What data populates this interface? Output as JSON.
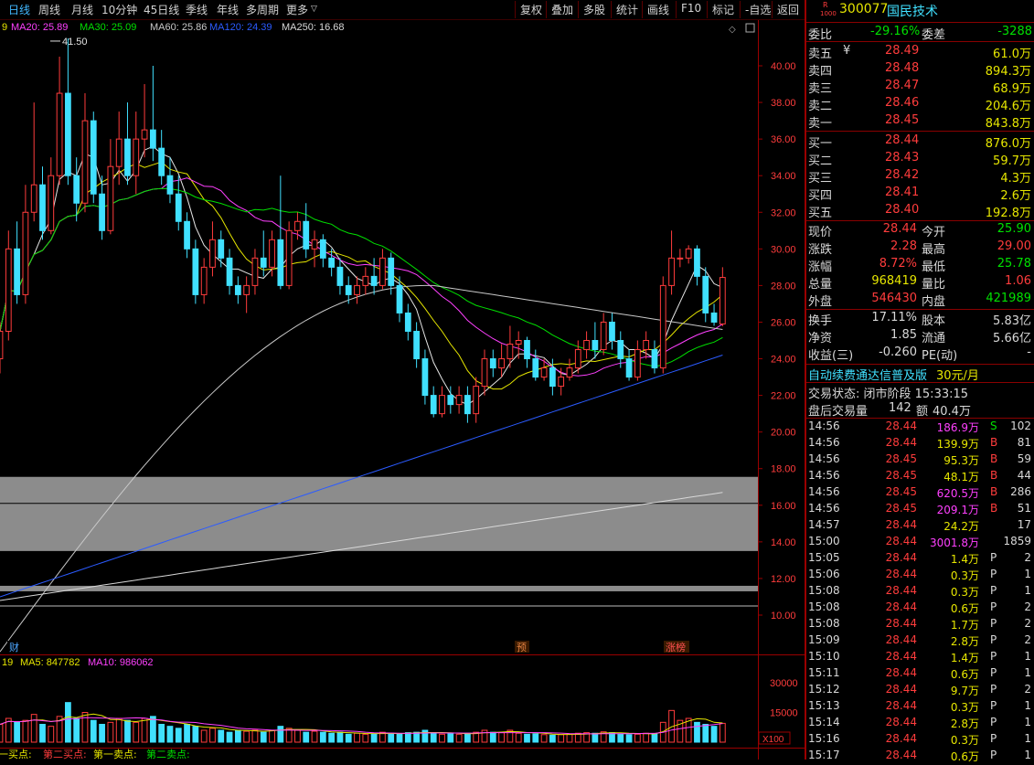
{
  "toolbar": {
    "left": [
      "日线",
      "周线",
      "月线",
      "10分钟",
      "45日线",
      "季线",
      "年线",
      "多周期",
      "更多"
    ],
    "more_arrow": "▽",
    "right": [
      "复权",
      "叠加",
      "多股",
      "统计",
      "画线",
      "F10",
      "标记",
      "-自选",
      "返回"
    ]
  },
  "ma_legend": {
    "first_fragment": "9",
    "items": [
      {
        "label": "MA20: 25.89",
        "color": "#ff40ff"
      },
      {
        "label": "MA30: 25.09",
        "color": "#00e000"
      },
      {
        "label": "MA60: 25.86",
        "color": "#c8c8c8"
      },
      {
        "label": "MA120: 24.39",
        "color": "#2b5bff"
      },
      {
        "label": "MA250: 16.68",
        "color": "#d8d8d8"
      }
    ]
  },
  "price_axis": [
    "40.00",
    "38.00",
    "36.00",
    "34.00",
    "32.00",
    "30.00",
    "28.00",
    "26.00",
    "24.00",
    "22.00",
    "20.00",
    "18.00",
    "16.00",
    "14.00",
    "12.00",
    "10.00"
  ],
  "high_marker": "41.50",
  "event_flags": [
    {
      "label": "财",
      "color": "#4da6ff"
    },
    {
      "label": "预",
      "color": "#e08040"
    },
    {
      "label": "涨榜",
      "color": "#ff5050"
    }
  ],
  "vol_legend": {
    "first": "19",
    "ma5": "MA5: 847782",
    "ma10": "MA10: 986062"
  },
  "vol_axis": [
    "30000",
    "15000"
  ],
  "vol_unit": "X100",
  "signals": [
    "第一买点:",
    "第二买点:",
    "第一卖点:",
    "第二卖点:"
  ],
  "signal_first_fragment": "一买点:",
  "stock": {
    "code": "300077",
    "name": "国民技术",
    "badge_top": "R",
    "badge_bottom": "1000"
  },
  "weibi": {
    "label": "委比",
    "value": "-29.16%",
    "diff_label": "委差",
    "diff": "-3288"
  },
  "asks": [
    {
      "label": "卖五",
      "price": "28.49",
      "vol": "61.0万"
    },
    {
      "label": "卖四",
      "price": "28.48",
      "vol": "894.3万"
    },
    {
      "label": "卖三",
      "price": "28.47",
      "vol": "68.9万"
    },
    {
      "label": "卖二",
      "price": "28.46",
      "vol": "204.6万"
    },
    {
      "label": "卖一",
      "price": "28.45",
      "vol": "843.8万"
    }
  ],
  "ask_currency_mark": "¥",
  "bids": [
    {
      "label": "买一",
      "price": "28.44",
      "vol": "876.0万"
    },
    {
      "label": "买二",
      "price": "28.43",
      "vol": "59.7万"
    },
    {
      "label": "买三",
      "price": "28.42",
      "vol": "4.3万"
    },
    {
      "label": "买四",
      "price": "28.41",
      "vol": "2.6万"
    },
    {
      "label": "买五",
      "price": "28.40",
      "vol": "192.8万"
    }
  ],
  "quote": [
    {
      "l1": "现价",
      "v1": "28.44",
      "c1": "r",
      "l2": "今开",
      "v2": "25.90",
      "c2": "g"
    },
    {
      "l1": "涨跌",
      "v1": "2.28",
      "c1": "r",
      "l2": "最高",
      "v2": "29.00",
      "c2": "r"
    },
    {
      "l1": "涨幅",
      "v1": "8.72%",
      "c1": "r",
      "l2": "最低",
      "v2": "25.78",
      "c2": "g"
    },
    {
      "l1": "总量",
      "v1": "968419",
      "c1": "y",
      "l2": "量比",
      "v2": "1.06",
      "c2": "r"
    },
    {
      "l1": "外盘",
      "v1": "546430",
      "c1": "r",
      "l2": "内盘",
      "v2": "421989",
      "c2": "g"
    }
  ],
  "fundamentals": [
    {
      "l1": "换手",
      "v1": "17.11%",
      "l2": "股本",
      "v2": "5.83亿"
    },
    {
      "l1": "净资",
      "v1": "1.85",
      "l2": "流通",
      "v2": "5.66亿"
    },
    {
      "l1": "收益(三)",
      "v1": "-0.260",
      "l2": "PE(动)",
      "v2": "-"
    }
  ],
  "promo": {
    "text": "自动续费通达信普及版",
    "price": "30元/月"
  },
  "trade_status": {
    "label": "交易状态: 闭市阶段 15:33:15"
  },
  "after_hours": {
    "label": "盘后交易量",
    "vol": "142",
    "amt_label": "额",
    "amt": "40.4万"
  },
  "ticks": [
    {
      "t": "14:56",
      "p": "28.44",
      "v": "186.9万",
      "vc": "m",
      "s": "S",
      "sc": "g",
      "n": "102"
    },
    {
      "t": "14:56",
      "p": "28.44",
      "v": "139.9万",
      "vc": "y",
      "s": "B",
      "sc": "r",
      "n": "81"
    },
    {
      "t": "14:56",
      "p": "28.45",
      "v": "95.3万",
      "vc": "y",
      "s": "B",
      "sc": "r",
      "n": "59"
    },
    {
      "t": "14:56",
      "p": "28.45",
      "v": "48.1万",
      "vc": "y",
      "s": "B",
      "sc": "r",
      "n": "44"
    },
    {
      "t": "14:56",
      "p": "28.45",
      "v": "620.5万",
      "vc": "m",
      "s": "B",
      "sc": "r",
      "n": "286"
    },
    {
      "t": "14:56",
      "p": "28.45",
      "v": "209.1万",
      "vc": "m",
      "s": "B",
      "sc": "r",
      "n": "51"
    },
    {
      "t": "14:57",
      "p": "28.44",
      "v": "24.2万",
      "vc": "y",
      "s": "",
      "sc": "w",
      "n": "17"
    },
    {
      "t": "15:00",
      "p": "28.44",
      "v": "3001.8万",
      "vc": "m",
      "s": "",
      "sc": "w",
      "n": "1859"
    },
    {
      "t": "15:05",
      "p": "28.44",
      "v": "1.4万",
      "vc": "y",
      "s": "P",
      "sc": "w",
      "n": "2"
    },
    {
      "t": "15:06",
      "p": "28.44",
      "v": "0.3万",
      "vc": "y",
      "s": "P",
      "sc": "w",
      "n": "1"
    },
    {
      "t": "15:08",
      "p": "28.44",
      "v": "0.3万",
      "vc": "y",
      "s": "P",
      "sc": "w",
      "n": "1"
    },
    {
      "t": "15:08",
      "p": "28.44",
      "v": "0.6万",
      "vc": "y",
      "s": "P",
      "sc": "w",
      "n": "2"
    },
    {
      "t": "15:08",
      "p": "28.44",
      "v": "1.7万",
      "vc": "y",
      "s": "P",
      "sc": "w",
      "n": "2"
    },
    {
      "t": "15:09",
      "p": "28.44",
      "v": "2.8万",
      "vc": "y",
      "s": "P",
      "sc": "w",
      "n": "2"
    },
    {
      "t": "15:10",
      "p": "28.44",
      "v": "1.4万",
      "vc": "y",
      "s": "P",
      "sc": "w",
      "n": "1"
    },
    {
      "t": "15:11",
      "p": "28.44",
      "v": "0.6万",
      "vc": "y",
      "s": "P",
      "sc": "w",
      "n": "1"
    },
    {
      "t": "15:12",
      "p": "28.44",
      "v": "9.7万",
      "vc": "y",
      "s": "P",
      "sc": "w",
      "n": "2"
    },
    {
      "t": "15:13",
      "p": "28.44",
      "v": "0.3万",
      "vc": "y",
      "s": "P",
      "sc": "w",
      "n": "1"
    },
    {
      "t": "15:14",
      "p": "28.44",
      "v": "2.8万",
      "vc": "y",
      "s": "P",
      "sc": "w",
      "n": "1"
    },
    {
      "t": "15:16",
      "p": "28.44",
      "v": "0.3万",
      "vc": "y",
      "s": "P",
      "sc": "w",
      "n": "1"
    },
    {
      "t": "15:17",
      "p": "28.44",
      "v": "0.6万",
      "vc": "y",
      "s": "P",
      "sc": "w",
      "n": "1"
    }
  ],
  "colors": {
    "up": "#ff3c3c",
    "down": "#40e0ff",
    "ma5": "#e6e6e6",
    "ma10": "#e6e600",
    "ma20": "#ff40ff",
    "ma30": "#00e000",
    "ma60": "#c8c8c8",
    "ma120": "#2b5bff",
    "ma250": "#d8d8d8"
  },
  "chart_data": {
    "type": "candlestick",
    "ylim": [
      10,
      41.5
    ],
    "candles": [
      [
        24.0,
        25.5,
        23.2,
        26.0
      ],
      [
        25.5,
        30.0,
        25.0,
        31.0
      ],
      [
        30.0,
        27.5,
        27.0,
        31.5
      ],
      [
        27.5,
        32.0,
        27.0,
        33.5
      ],
      [
        32.0,
        33.5,
        31.5,
        38.0
      ],
      [
        33.5,
        31.0,
        30.5,
        34.5
      ],
      [
        31.0,
        34.0,
        30.8,
        35.0
      ],
      [
        34.0,
        38.5,
        33.5,
        40.5
      ],
      [
        38.5,
        34.0,
        33.5,
        41.5
      ],
      [
        34.0,
        32.5,
        31.5,
        35.0
      ],
      [
        32.5,
        37.0,
        32.0,
        38.5
      ],
      [
        37.0,
        33.0,
        32.5,
        37.5
      ],
      [
        33.0,
        31.0,
        30.5,
        34.0
      ],
      [
        31.0,
        34.5,
        30.8,
        36.0
      ],
      [
        34.5,
        36.0,
        33.5,
        37.5
      ],
      [
        36.0,
        34.0,
        33.5,
        38.0
      ],
      [
        34.0,
        36.0,
        33.0,
        37.5
      ],
      [
        36.0,
        36.5,
        35.0,
        39.0
      ],
      [
        36.5,
        35.5,
        34.8,
        40.0
      ],
      [
        35.5,
        34.0,
        33.5,
        36.5
      ],
      [
        34.0,
        33.0,
        32.5,
        35.0
      ],
      [
        33.0,
        31.5,
        31.0,
        34.0
      ],
      [
        31.5,
        30.0,
        29.5,
        32.0
      ],
      [
        30.0,
        27.5,
        27.0,
        30.5
      ],
      [
        27.5,
        29.0,
        27.0,
        29.5
      ],
      [
        29.0,
        30.5,
        28.5,
        31.5
      ],
      [
        30.5,
        29.5,
        29.0,
        31.0
      ],
      [
        29.5,
        28.0,
        27.5,
        30.0
      ],
      [
        28.0,
        27.5,
        27.0,
        28.5
      ],
      [
        27.5,
        28.0,
        26.5,
        28.5
      ],
      [
        28.0,
        29.5,
        27.5,
        30.0
      ],
      [
        29.5,
        29.0,
        28.5,
        31.0
      ],
      [
        29.0,
        30.5,
        28.5,
        31.0
      ],
      [
        30.5,
        28.0,
        27.8,
        34.0
      ],
      [
        28.0,
        31.0,
        27.8,
        31.5
      ],
      [
        31.0,
        31.5,
        30.5,
        32.0
      ],
      [
        31.5,
        30.0,
        29.5,
        32.5
      ],
      [
        30.0,
        30.5,
        29.0,
        31.0
      ],
      [
        30.5,
        29.5,
        29.0,
        30.8
      ],
      [
        29.5,
        29.0,
        28.5,
        30.0
      ],
      [
        29.0,
        28.0,
        27.5,
        29.5
      ],
      [
        28.0,
        27.5,
        27.0,
        28.5
      ],
      [
        27.5,
        28.0,
        27.0,
        28.5
      ],
      [
        28.0,
        28.5,
        27.5,
        29.0
      ],
      [
        28.5,
        28.0,
        27.5,
        29.5
      ],
      [
        28.0,
        29.5,
        27.8,
        30.0
      ],
      [
        29.5,
        28.0,
        27.5,
        29.8
      ],
      [
        28.0,
        26.5,
        26.0,
        28.5
      ],
      [
        26.5,
        25.5,
        25.0,
        27.0
      ],
      [
        25.5,
        24.0,
        23.5,
        26.0
      ],
      [
        24.0,
        22.0,
        21.5,
        24.5
      ],
      [
        22.0,
        21.0,
        20.8,
        22.5
      ],
      [
        21.0,
        22.0,
        20.8,
        22.5
      ],
      [
        22.0,
        21.5,
        21.0,
        22.5
      ],
      [
        21.5,
        22.0,
        21.0,
        22.5
      ],
      [
        22.0,
        21.0,
        20.5,
        22.5
      ],
      [
        21.0,
        22.5,
        20.5,
        23.0
      ],
      [
        22.5,
        24.0,
        22.0,
        24.5
      ],
      [
        24.0,
        23.5,
        23.0,
        24.5
      ],
      [
        23.5,
        24.0,
        23.0,
        24.8
      ],
      [
        24.0,
        24.8,
        23.5,
        25.8
      ],
      [
        24.8,
        25.0,
        24.0,
        25.5
      ],
      [
        25.0,
        24.0,
        23.5,
        25.2
      ],
      [
        24.0,
        23.0,
        22.8,
        24.5
      ],
      [
        23.0,
        23.5,
        22.8,
        24.0
      ],
      [
        23.5,
        22.5,
        22.0,
        24.0
      ],
      [
        22.5,
        23.0,
        22.0,
        23.5
      ],
      [
        23.0,
        23.5,
        22.8,
        24.0
      ],
      [
        23.5,
        24.5,
        23.2,
        25.0
      ],
      [
        24.5,
        25.0,
        24.0,
        25.5
      ],
      [
        25.0,
        24.5,
        24.0,
        26.0
      ],
      [
        24.5,
        26.0,
        24.2,
        26.5
      ],
      [
        26.0,
        25.0,
        24.5,
        26.5
      ],
      [
        25.0,
        24.0,
        23.5,
        25.5
      ],
      [
        24.0,
        23.0,
        22.8,
        24.5
      ],
      [
        23.0,
        24.5,
        22.8,
        25.0
      ],
      [
        24.5,
        25.0,
        24.0,
        25.5
      ],
      [
        24.5,
        23.5,
        23.2,
        25.0
      ],
      [
        23.5,
        28.0,
        23.2,
        28.5
      ],
      [
        28.0,
        29.5,
        27.5,
        31.0
      ],
      [
        29.5,
        29.5,
        29.0,
        30.0
      ],
      [
        29.5,
        30.0,
        29.2,
        30.2
      ],
      [
        30.0,
        28.5,
        28.0,
        30.2
      ],
      [
        28.5,
        26.5,
        26.0,
        29.0
      ],
      [
        26.5,
        26.0,
        25.8,
        27.0
      ],
      [
        25.9,
        28.44,
        25.78,
        29.0
      ]
    ],
    "volume": [
      9000,
      12000,
      10000,
      11000,
      14000,
      9000,
      8000,
      13000,
      20000,
      12000,
      15000,
      11000,
      9000,
      10000,
      12000,
      11000,
      10000,
      12000,
      13000,
      9000,
      8000,
      7000,
      9000,
      8000,
      6000,
      7000,
      6000,
      5000,
      6000,
      5500,
      6000,
      5000,
      6000,
      8000,
      7000,
      6000,
      5000,
      5500,
      5000,
      4500,
      5000,
      4000,
      4500,
      4000,
      4200,
      5000,
      4500,
      4000,
      4800,
      5000,
      6000,
      4500,
      4000,
      4200,
      4000,
      4500,
      5000,
      6000,
      5000,
      4800,
      6000,
      4500,
      4000,
      4200,
      3800,
      3500,
      3800,
      4000,
      4500,
      4800,
      4500,
      5200,
      4800,
      4200,
      3800,
      4000,
      4500,
      4200,
      10000,
      16000,
      11000,
      12000,
      10000,
      9000,
      8000,
      9500
    ]
  }
}
